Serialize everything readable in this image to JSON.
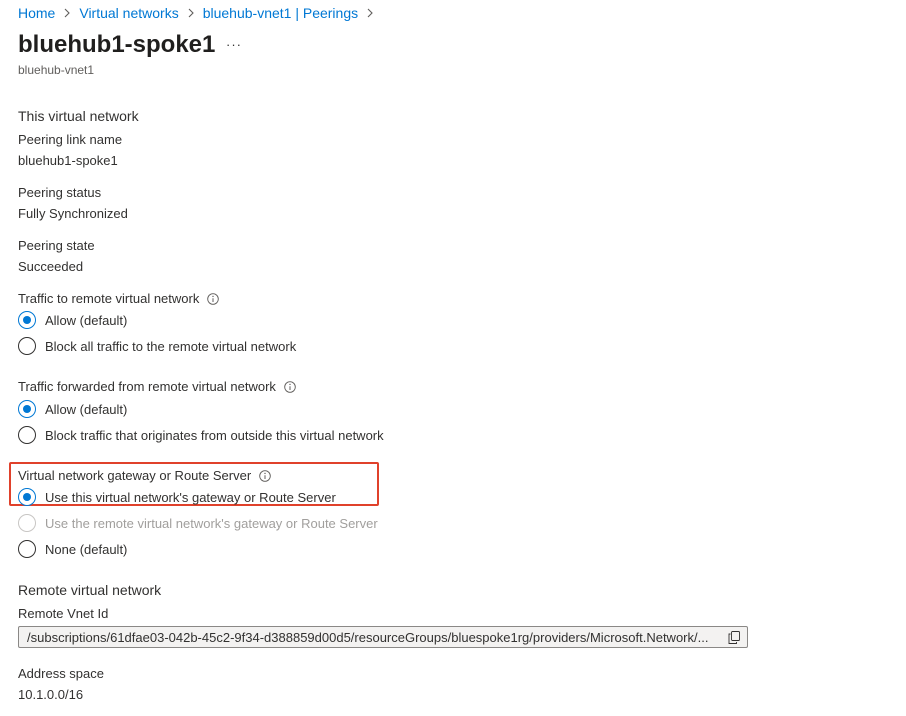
{
  "breadcrumb": [
    "Home",
    "Virtual networks",
    "bluehub-vnet1 | Peerings"
  ],
  "page": {
    "title": "bluehub1-spoke1",
    "subtitle": "bluehub-vnet1",
    "more_label": "···"
  },
  "this_network": {
    "heading": "This virtual network",
    "link_name_label": "Peering link name",
    "link_name_value": "bluehub1-spoke1",
    "status_label": "Peering status",
    "status_value": "Fully Synchronized",
    "state_label": "Peering state",
    "state_value": "Succeeded"
  },
  "traffic_to_remote": {
    "label": "Traffic to remote virtual network",
    "options": [
      "Allow (default)",
      "Block all traffic to the remote virtual network"
    ],
    "selected": 0
  },
  "traffic_forwarded": {
    "label": "Traffic forwarded from remote virtual network",
    "options": [
      "Allow (default)",
      "Block traffic that originates from outside this virtual network"
    ],
    "selected": 0
  },
  "gateway": {
    "label": "Virtual network gateway or Route Server",
    "options": [
      "Use this virtual network's gateway or Route Server",
      "Use the remote virtual network's gateway or Route Server",
      "None (default)"
    ],
    "selected": 0,
    "disabled_option": 1,
    "highlight_color": "#e0412b"
  },
  "remote_network": {
    "heading": "Remote virtual network",
    "vnet_id_label": "Remote Vnet Id",
    "vnet_id_value": "/subscriptions/61dfae03-042b-45c2-9f34-d388859d00d5/resourceGroups/bluespoke1rg/providers/Microsoft.Network/...",
    "address_space_label": "Address space",
    "address_space_value": "10.1.0.0/16"
  },
  "colors": {
    "accent": "#0078d4",
    "text": "#323130",
    "muted": "#605e5c"
  }
}
